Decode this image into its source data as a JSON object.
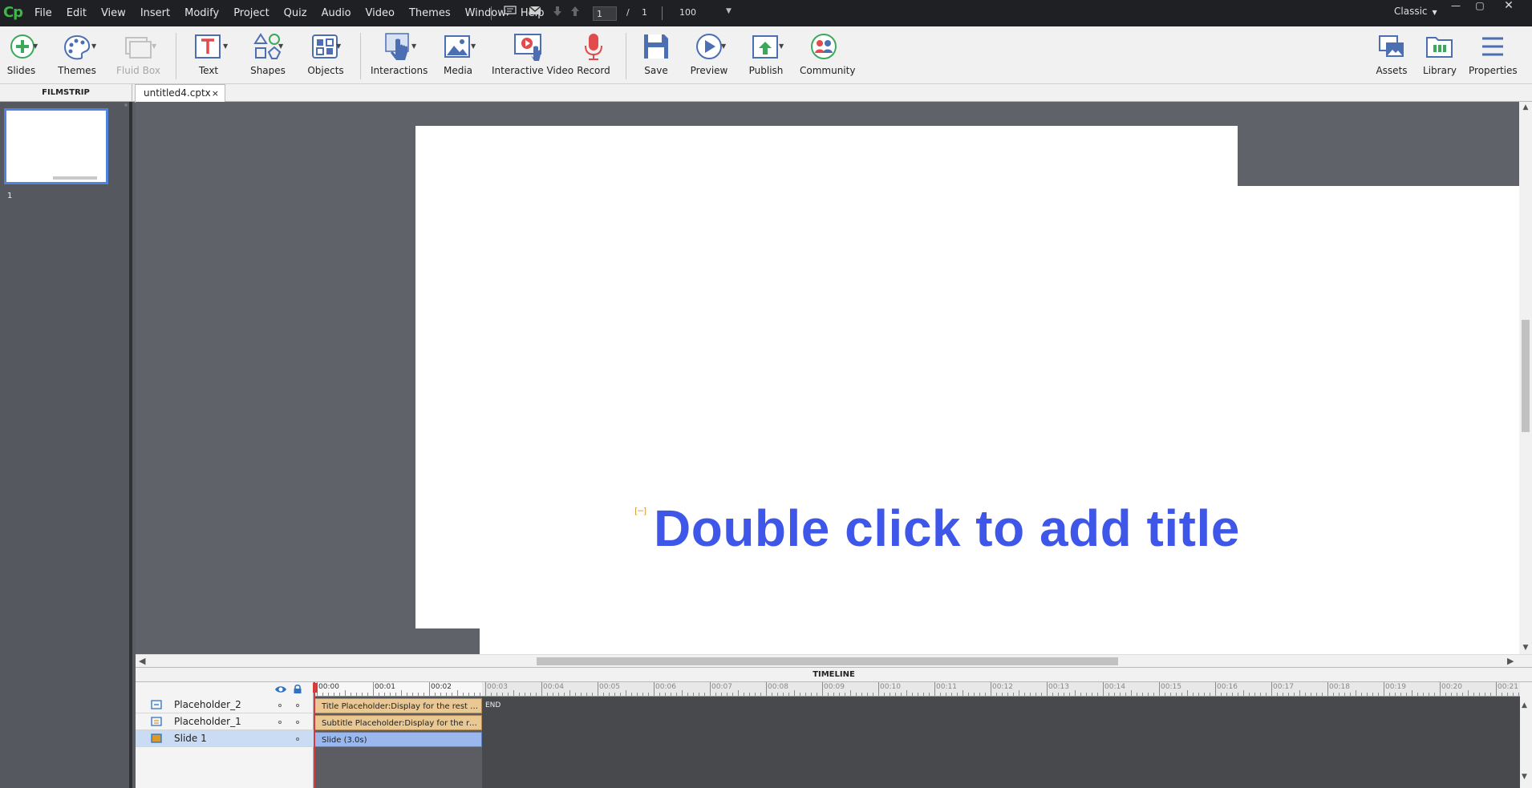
{
  "app": {
    "logo": "Cp"
  },
  "menubar": {
    "items": [
      "File",
      "Edit",
      "View",
      "Insert",
      "Modify",
      "Project",
      "Quiz",
      "Audio",
      "Video",
      "Themes",
      "Window",
      "Help"
    ],
    "page_current": "1",
    "page_sep": "/",
    "page_total": "1",
    "zoom": "100",
    "workspace": "Classic"
  },
  "toolbar": {
    "slides": "Slides",
    "themes": "Themes",
    "fluidbox": "Fluid Box",
    "text": "Text",
    "shapes": "Shapes",
    "objects": "Objects",
    "interactions": "Interactions",
    "media": "Media",
    "interactive_video": "Interactive Video",
    "record": "Record",
    "save": "Save",
    "preview": "Preview",
    "publish": "Publish",
    "community": "Community",
    "assets": "Assets",
    "library": "Library",
    "properties": "Properties"
  },
  "filmstrip": {
    "label": "FILMSTRIP",
    "slide_number": "1"
  },
  "document": {
    "tab_name": "untitled4.cptx",
    "close": "×"
  },
  "stage": {
    "title_placeholder": "Double click to add title"
  },
  "timeline": {
    "label": "TIMELINE",
    "layers": [
      {
        "name": "Placeholder_2",
        "bar": "Title Placeholder:Display for the rest of the slide"
      },
      {
        "name": "Placeholder_1",
        "bar": "Subtitle Placeholder:Display for the rest of the slide"
      },
      {
        "name": "Slide 1",
        "bar": "Slide (3.0s)"
      }
    ],
    "end_label": "END",
    "ruler": [
      "00:00",
      "00:01",
      "00:02",
      "00:03",
      "00:04",
      "00:05",
      "00:06",
      "00:07",
      "00:08",
      "00:09",
      "00:10",
      "00:11",
      "00:12",
      "00:13",
      "00:14",
      "00:15",
      "00:16",
      "00:17",
      "00:18",
      "00:19",
      "00:20",
      "00:21"
    ]
  },
  "colors": {
    "accent_blue": "#3e57e8",
    "selection_blue": "#4e84dd",
    "playhead_red": "#d73a3a",
    "logo_green": "#3fb54a"
  }
}
